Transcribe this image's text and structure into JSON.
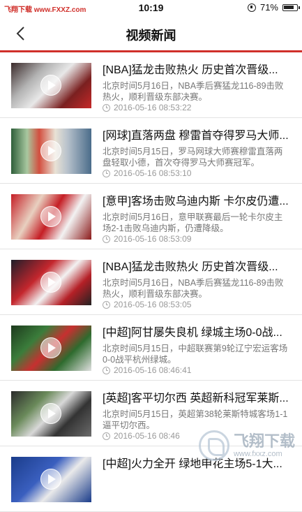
{
  "status_bar": {
    "left_label": "飞翔下载 www.FXXZ.com",
    "time": "10:19",
    "battery": "71%"
  },
  "nav": {
    "title": "视频新闻"
  },
  "news": [
    {
      "title": "[NBA]猛龙击败热火 历史首次晋级...",
      "summary": "北京时间5月16日，NBA季后赛猛龙116-89击败热火，顺利晋级东部决赛。",
      "time": "2016-05-16 08:53:22"
    },
    {
      "title": "[网球]直落两盘 穆雷首夺得罗马大师...",
      "summary": "北京时间5月15日，罗马网球大师赛穆雷直落两盘轻取小德，首次夺得罗马大师赛冠军。",
      "time": "2016-05-16 08:53:10"
    },
    {
      "title": "[意甲]客场击败乌迪内斯 卡尔皮仍遭...",
      "summary": "北京时间5月16日，意甲联赛最后一轮卡尔皮主场2-1击败乌迪内斯，仍遭降级。",
      "time": "2016-05-16 08:53:09"
    },
    {
      "title": "[NBA]猛龙击败热火 历史首次晋级...",
      "summary": "北京时间5月16日，NBA季后赛猛龙116-89击败热火，顺利晋级东部决赛。",
      "time": "2016-05-16 08:53:05"
    },
    {
      "title": "[中超]阿甘屡失良机 绿城主场0-0战...",
      "summary": "北京时间5月15日，中超联赛第9轮辽宁宏运客场0-0战平杭州绿城。",
      "time": "2016-05-16 08:46:41"
    },
    {
      "title": "[英超]客平切尔西 英超新科冠军莱斯...",
      "summary": "北京时间5月15日，英超第38轮莱斯特城客场1-1逼平切尔西。",
      "time": "2016-05-16 08:46"
    },
    {
      "title": "[中超]火力全开 绿地申花主场5-1大...",
      "summary": "",
      "time": ""
    }
  ],
  "watermark": {
    "text": "飞翔下载",
    "url": "www.fxxz.com"
  },
  "colors": {
    "accent": "#d0302b",
    "divider": "#e3e3e3",
    "meta_text": "#999999"
  },
  "icons": [
    "back-arrow-icon",
    "clock-icon",
    "play-icon",
    "battery-icon",
    "rotation-lock-icon"
  ]
}
